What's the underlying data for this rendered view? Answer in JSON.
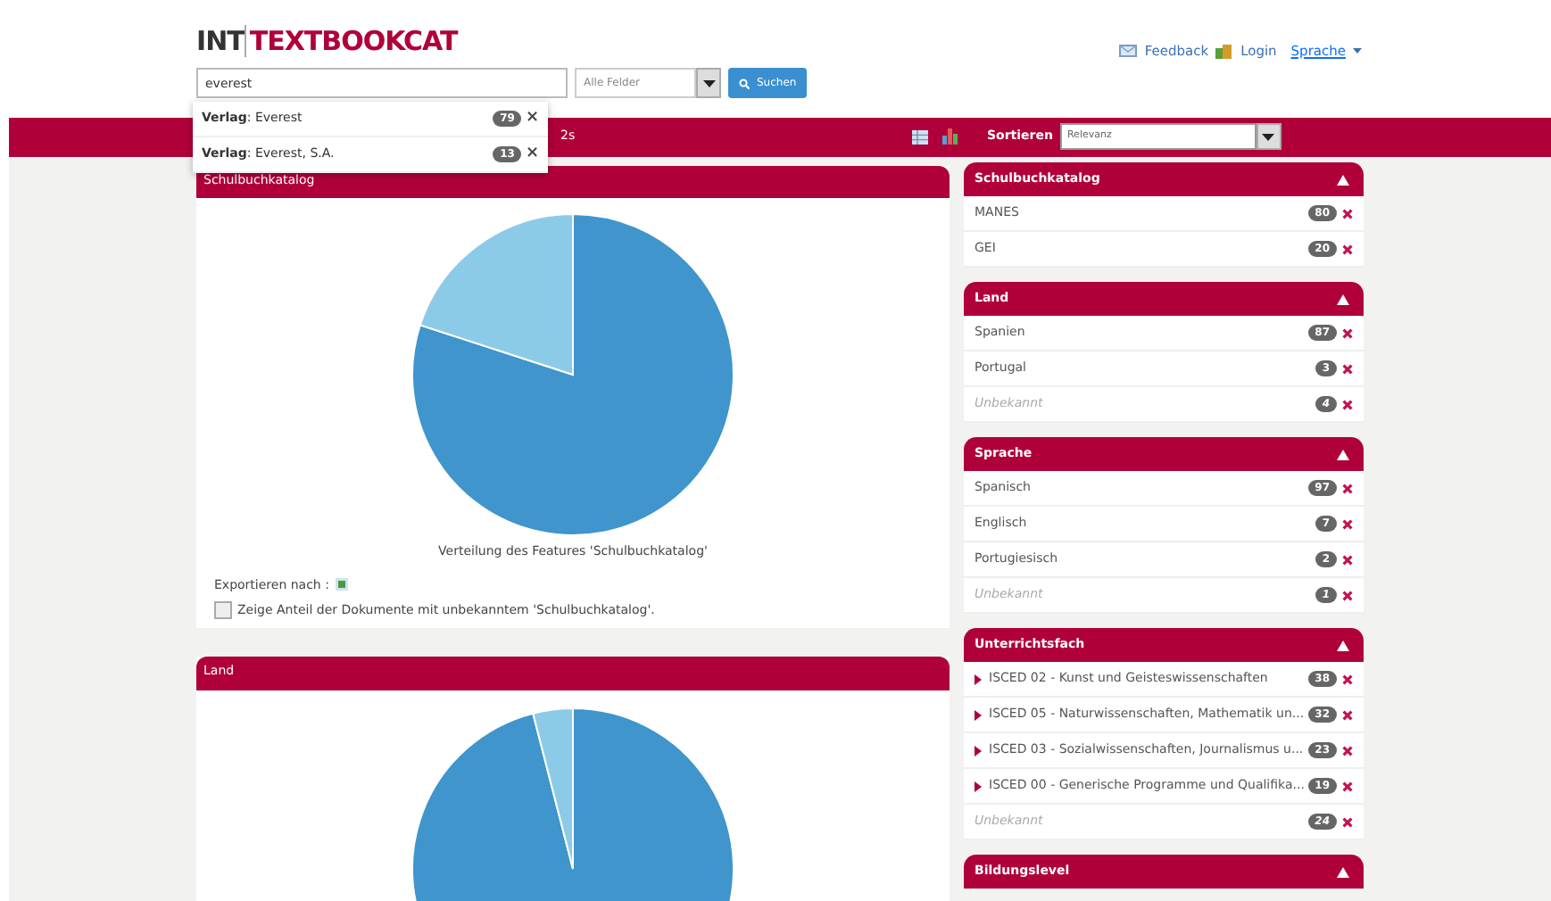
{
  "logo": {
    "part_1": "INT",
    "part_2": "TEXTBOOKCAT"
  },
  "search": {
    "value": "everest",
    "field_select": "Alle Felder",
    "button": "Suchen"
  },
  "autocomplete": [
    {
      "text": "**Verlag**: Everest",
      "count": "79",
      "remove": "×"
    },
    {
      "text": "**Verlag**: Everest, S.A.",
      "count": "13",
      "remove": "×"
    }
  ],
  "top_links": {
    "feedback": "Feedback",
    "login": "Login",
    "language": "Sprache"
  },
  "results_bar": {
    "partial_text": "2s",
    "sort_label": "Sortieren",
    "sort_value": "Relevanz"
  },
  "charts": [
    {
      "title": "Schulbuchkatalog",
      "caption": "Verteilung des Features 'Schulbuchkatalog'",
      "export_label": "Exportieren nach :",
      "unknown_option": {
        "label": "Zeige Anteil der Dokumente mit unbekanntem 'Schulbuchkatalog'.",
        "checked": false
      }
    },
    {
      "title": "Land"
    }
  ],
  "facets": [
    {
      "title": "Schulbuchkatalog",
      "expanded": true,
      "items": [
        {
          "kind": "value",
          "label": "MANES",
          "count": "80"
        },
        {
          "kind": "value",
          "label": "GEI",
          "count": "20"
        }
      ]
    },
    {
      "title": "Land",
      "expanded": true,
      "items": [
        {
          "kind": "value",
          "label": "Spanien",
          "count": "87"
        },
        {
          "kind": "value",
          "label": "Portugal",
          "count": "3"
        },
        {
          "kind": "unknown",
          "label": "Unbekannt",
          "count": "4"
        }
      ]
    },
    {
      "title": "Sprache",
      "expanded": true,
      "items": [
        {
          "kind": "value",
          "label": "Spanisch",
          "count": "97"
        },
        {
          "kind": "value",
          "label": "Englisch",
          "count": "7"
        },
        {
          "kind": "value",
          "label": "Portugiesisch",
          "count": "2"
        },
        {
          "kind": "unknown",
          "label": "Unbekannt",
          "count": "1"
        }
      ]
    },
    {
      "title": "Unterrichtsfach",
      "expanded": true,
      "items": [
        {
          "kind": "group",
          "label": "ISCED 02 - Kunst und Geisteswissenschaften",
          "count": "38"
        },
        {
          "kind": "group",
          "label": "ISCED 05 - Naturwissenschaften, Mathematik un...",
          "count": "32"
        },
        {
          "kind": "group",
          "label": "ISCED 03 - Sozialwissenschaften, Journalismus u...",
          "count": "23"
        },
        {
          "kind": "group",
          "label": "ISCED 00 - Generische Programme und Qualifika...",
          "count": "19"
        },
        {
          "kind": "unknown",
          "label": "Unbekannt",
          "count": "24"
        }
      ]
    },
    {
      "title": "Bildungslevel",
      "expanded": true
    }
  ]
}
